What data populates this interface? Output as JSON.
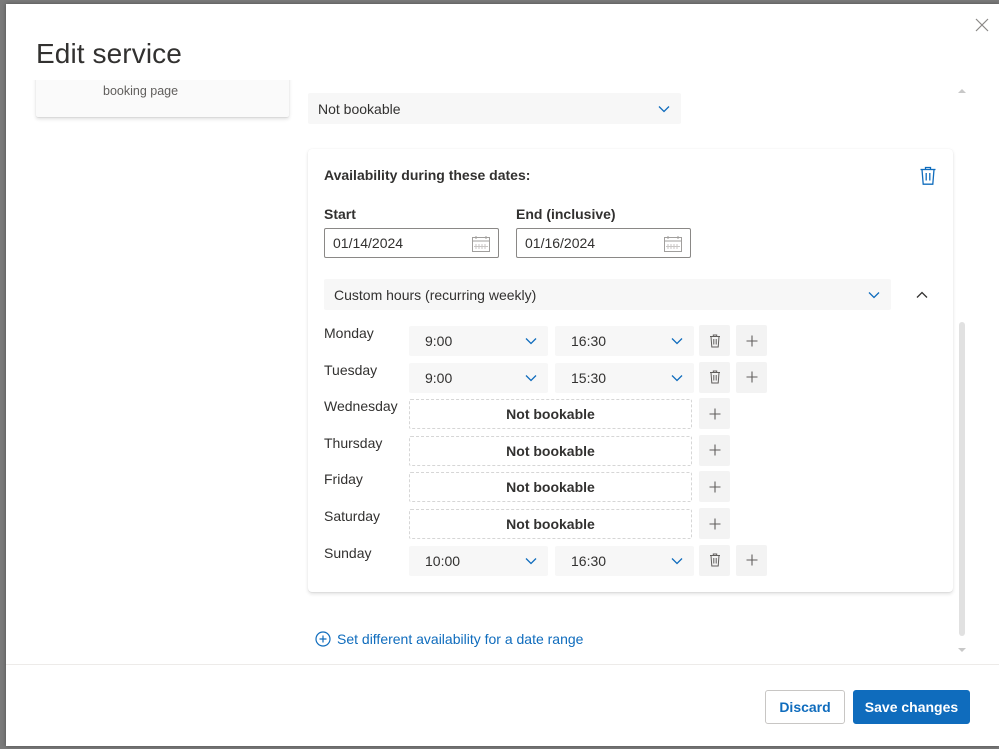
{
  "dialog": {
    "title": "Edit service",
    "close_icon": "close-icon"
  },
  "left_card": {
    "text": "booking page"
  },
  "default_availability": {
    "selected": "Not bookable"
  },
  "availability_card": {
    "heading": "Availability during these dates:",
    "delete_icon": "trash-icon",
    "start": {
      "label": "Start",
      "value": "01/14/2024"
    },
    "end": {
      "label": "End (inclusive)",
      "value": "01/16/2024"
    },
    "hours_type": {
      "selected": "Custom hours (recurring weekly)"
    },
    "days": [
      {
        "name": "Monday",
        "bookable": true,
        "start": "9:00",
        "end": "16:30"
      },
      {
        "name": "Tuesday",
        "bookable": true,
        "start": "9:00",
        "end": "15:30"
      },
      {
        "name": "Wednesday",
        "bookable": false,
        "label": "Not bookable"
      },
      {
        "name": "Thursday",
        "bookable": false,
        "label": "Not bookable"
      },
      {
        "name": "Friday",
        "bookable": false,
        "label": "Not bookable"
      },
      {
        "name": "Saturday",
        "bookable": false,
        "label": "Not bookable"
      },
      {
        "name": "Sunday",
        "bookable": true,
        "start": "10:00",
        "end": "16:30"
      }
    ]
  },
  "add_range_link": "Set different availability for a date range",
  "footer": {
    "discard_label": "Discard",
    "save_label": "Save changes"
  },
  "colors": {
    "accent": "#0f6cbd",
    "text": "#323130",
    "field_bg": "#f7f7f7"
  }
}
